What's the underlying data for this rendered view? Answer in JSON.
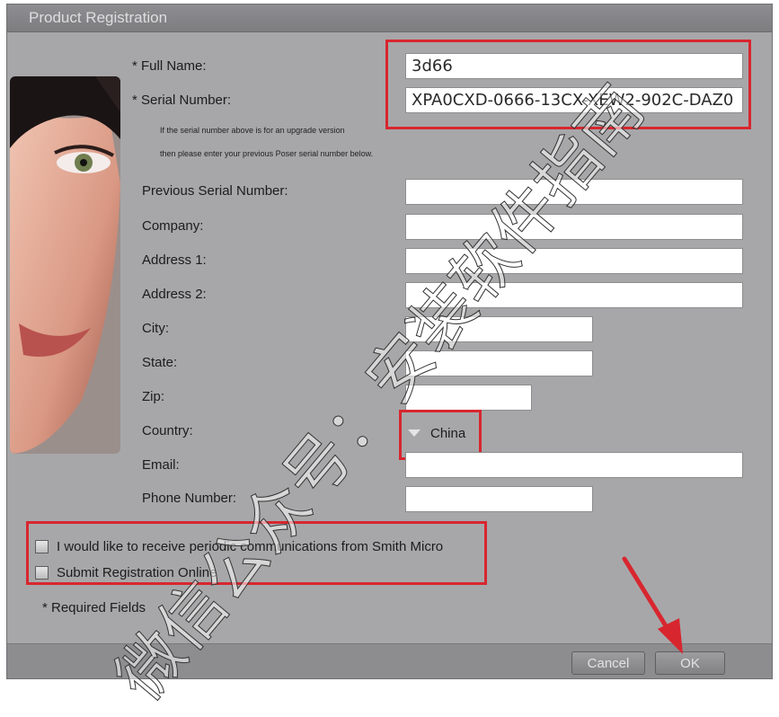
{
  "window": {
    "title": "Product Registration"
  },
  "form": {
    "full_name_label": "* Full Name:",
    "full_name_value": "3d66",
    "serial_label": "* Serial Number:",
    "serial_value": "XPA0CXD-0666-13CX-XEW2-902C-DAZ0",
    "upgrade_note_line1": "If the serial number above is for an upgrade version",
    "upgrade_note_line2": "then please enter your previous Poser serial number below.",
    "previous_serial_label": "Previous Serial Number:",
    "company_label": "Company:",
    "address1_label": "Address 1:",
    "address2_label": "Address 2:",
    "city_label": "City:",
    "state_label": "State:",
    "zip_label": "Zip:",
    "country_label": "Country:",
    "country_value": "China",
    "email_label": "Email:",
    "phone_label": "Phone Number:"
  },
  "options": {
    "communications_label": "I would like to receive periodic communications from Smith Micro",
    "submit_online_label": "Submit Registration Online"
  },
  "required_note": "* Required Fields",
  "buttons": {
    "cancel": "Cancel",
    "ok": "OK"
  },
  "watermark": "微信公众号：安装软件指南",
  "colors": {
    "annotation": "#d8262f",
    "window_bg": "#a7a7a9"
  }
}
